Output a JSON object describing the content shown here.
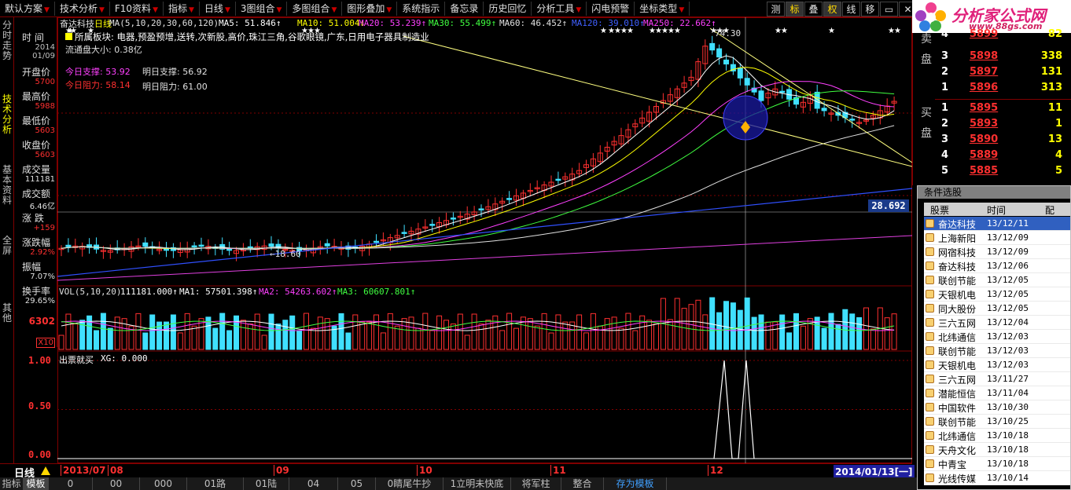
{
  "menu": [
    "默认方案",
    "技术分析",
    "F10资料",
    "指标",
    "日线",
    "3图组合",
    "多图组合",
    "图形叠加",
    "系统指示",
    "备忘录",
    "历史回忆",
    "分析工具",
    "闪电预警",
    "坐标类型"
  ],
  "right_buttons": [
    "测",
    "标",
    "叠",
    "权",
    "线",
    "移"
  ],
  "logo": {
    "text": "分析家公式网",
    "url": "www.88gs.com"
  },
  "left_tabs": [
    "分时走势",
    "技术分析",
    "基本资料",
    "全屏",
    "其他"
  ],
  "info": {
    "rows": [
      {
        "label": "时 间",
        "value": "2014",
        "value2": "01/09",
        "color": "#c0c0c0"
      },
      {
        "label": "开盘价",
        "value": "5700",
        "color": "#ff3030"
      },
      {
        "label": "最高价",
        "value": "5988",
        "color": "#ff3030"
      },
      {
        "label": "最低价",
        "value": "5603",
        "color": "#ff3030"
      },
      {
        "label": "收盘价",
        "value": "5603",
        "color": "#ff3030"
      },
      {
        "label": "成交量",
        "value": "111181",
        "color": "#e0e0e0"
      },
      {
        "label": "成交额",
        "value": "6.46亿",
        "color": "#e0e0e0"
      },
      {
        "label": "涨 跌",
        "value": "+159",
        "color": "#ff3030"
      },
      {
        "label": "涨跌幅",
        "value": "2.92%",
        "color": "#ff3030"
      },
      {
        "label": "振幅",
        "value": "7.07%",
        "color": "#e0e0e0"
      },
      {
        "label": "换手率",
        "value": "29.65%",
        "color": "#e0e0e0"
      }
    ],
    "vol_scale": "6302",
    "x10": "X10"
  },
  "chart_header": {
    "stock": "奋达科技",
    "period": "日线",
    "ma_label": "MA(5,10,20,30,60,120)",
    "ma5": "MA5: 51.846↑",
    "ma10": "MA10: 51.004↓",
    "ma20": "MA20: 53.239↑",
    "ma30": "MA30: 55.499↑",
    "ma60": "MA60: 46.452↑",
    "ma120": "MA120: 39.010↑",
    "ma250": "MA250: 22.662↑",
    "sector": "所属板块: 电器,预盈预增,送转,次新股,高价,珠江三角,谷歌眼镜,广东,日用电子器具制造业",
    "float_cap": "流通盘大小: 0.38亿",
    "support_today": "今日支撑: 53.92",
    "support_tomorrow": "明日支撑: 56.92",
    "resist_today": "今日阻力: 58.14",
    "resist_tomorrow": "明日阻力: 61.00",
    "price_tag": "28.692",
    "low_mark": "←18.60",
    "high_mark": "74.30"
  },
  "vol_header": {
    "label": "VOL(5,10,20)",
    "vol": "111181.000↑",
    "ma1": "MA1: 57501.398↑",
    "ma2": "MA2: 54263.602↑",
    "ma3": "MA3: 60607.801↑"
  },
  "ind_header": {
    "label": "出票就买",
    "xg": "XG: 0.000",
    "ticks": [
      "1.00",
      "0.50",
      "0.00"
    ]
  },
  "date_axis": [
    "2013/07",
    "08",
    "09",
    "10",
    "11",
    "12"
  ],
  "date_end": "2014/01/13[一]",
  "quotes": {
    "sell_label": "卖盘",
    "buy_label": "买盘",
    "sell": [
      {
        "level": "4",
        "price": "5899",
        "vol": "82"
      },
      {
        "level": "3",
        "price": "5898",
        "vol": "338"
      },
      {
        "level": "2",
        "price": "5897",
        "vol": "131"
      },
      {
        "level": "1",
        "price": "5896",
        "vol": "313"
      }
    ],
    "buy": [
      {
        "level": "1",
        "price": "5895",
        "vol": "11"
      },
      {
        "level": "2",
        "price": "5893",
        "vol": "1"
      },
      {
        "level": "3",
        "price": "5890",
        "vol": "13"
      },
      {
        "level": "4",
        "price": "5889",
        "vol": "4"
      },
      {
        "level": "5",
        "price": "5885",
        "vol": "5"
      }
    ]
  },
  "screener": {
    "title": "条件选股",
    "headers": [
      "股票",
      "时间",
      "配"
    ],
    "rows": [
      {
        "name": "奋达科技",
        "date": "13/12/11"
      },
      {
        "name": "上海新阳",
        "date": "13/12/09"
      },
      {
        "name": "网宿科技",
        "date": "13/12/09"
      },
      {
        "name": "奋达科技",
        "date": "13/12/06"
      },
      {
        "name": "联创节能",
        "date": "13/12/05"
      },
      {
        "name": "天银机电",
        "date": "13/12/05"
      },
      {
        "name": "同大股份",
        "date": "13/12/05"
      },
      {
        "name": "三六五网",
        "date": "13/12/04"
      },
      {
        "name": "北纬通信",
        "date": "13/12/03"
      },
      {
        "name": "联创节能",
        "date": "13/12/03"
      },
      {
        "name": "天银机电",
        "date": "13/12/03"
      },
      {
        "name": "三六五网",
        "date": "13/11/27"
      },
      {
        "name": "潜能恒信",
        "date": "13/11/04"
      },
      {
        "name": "中国软件",
        "date": "13/10/30"
      },
      {
        "name": "联创节能",
        "date": "13/10/25"
      },
      {
        "name": "北纬通信",
        "date": "13/10/18"
      },
      {
        "name": "天舟文化",
        "date": "13/10/18"
      },
      {
        "name": "中青宝",
        "date": "13/10/18"
      },
      {
        "name": "光线传媒",
        "date": "13/10/14"
      }
    ]
  },
  "bottom_tabs": [
    "指标",
    "模板",
    "0",
    "00",
    "000",
    "01路",
    "01陆",
    "04",
    "05",
    "0睛尾牛抄",
    "1立明未快底",
    "将军柱",
    "整合",
    "存为模板"
  ],
  "bottom_label": "日线",
  "chart_data": {
    "type": "candlestick",
    "ylim": [
      15,
      76
    ],
    "main_price_tag": 28.692,
    "annotated_low": 18.6,
    "annotated_high": 74.3,
    "indicator_xg_peaks": [
      "2013-12 (two signals)"
    ]
  }
}
